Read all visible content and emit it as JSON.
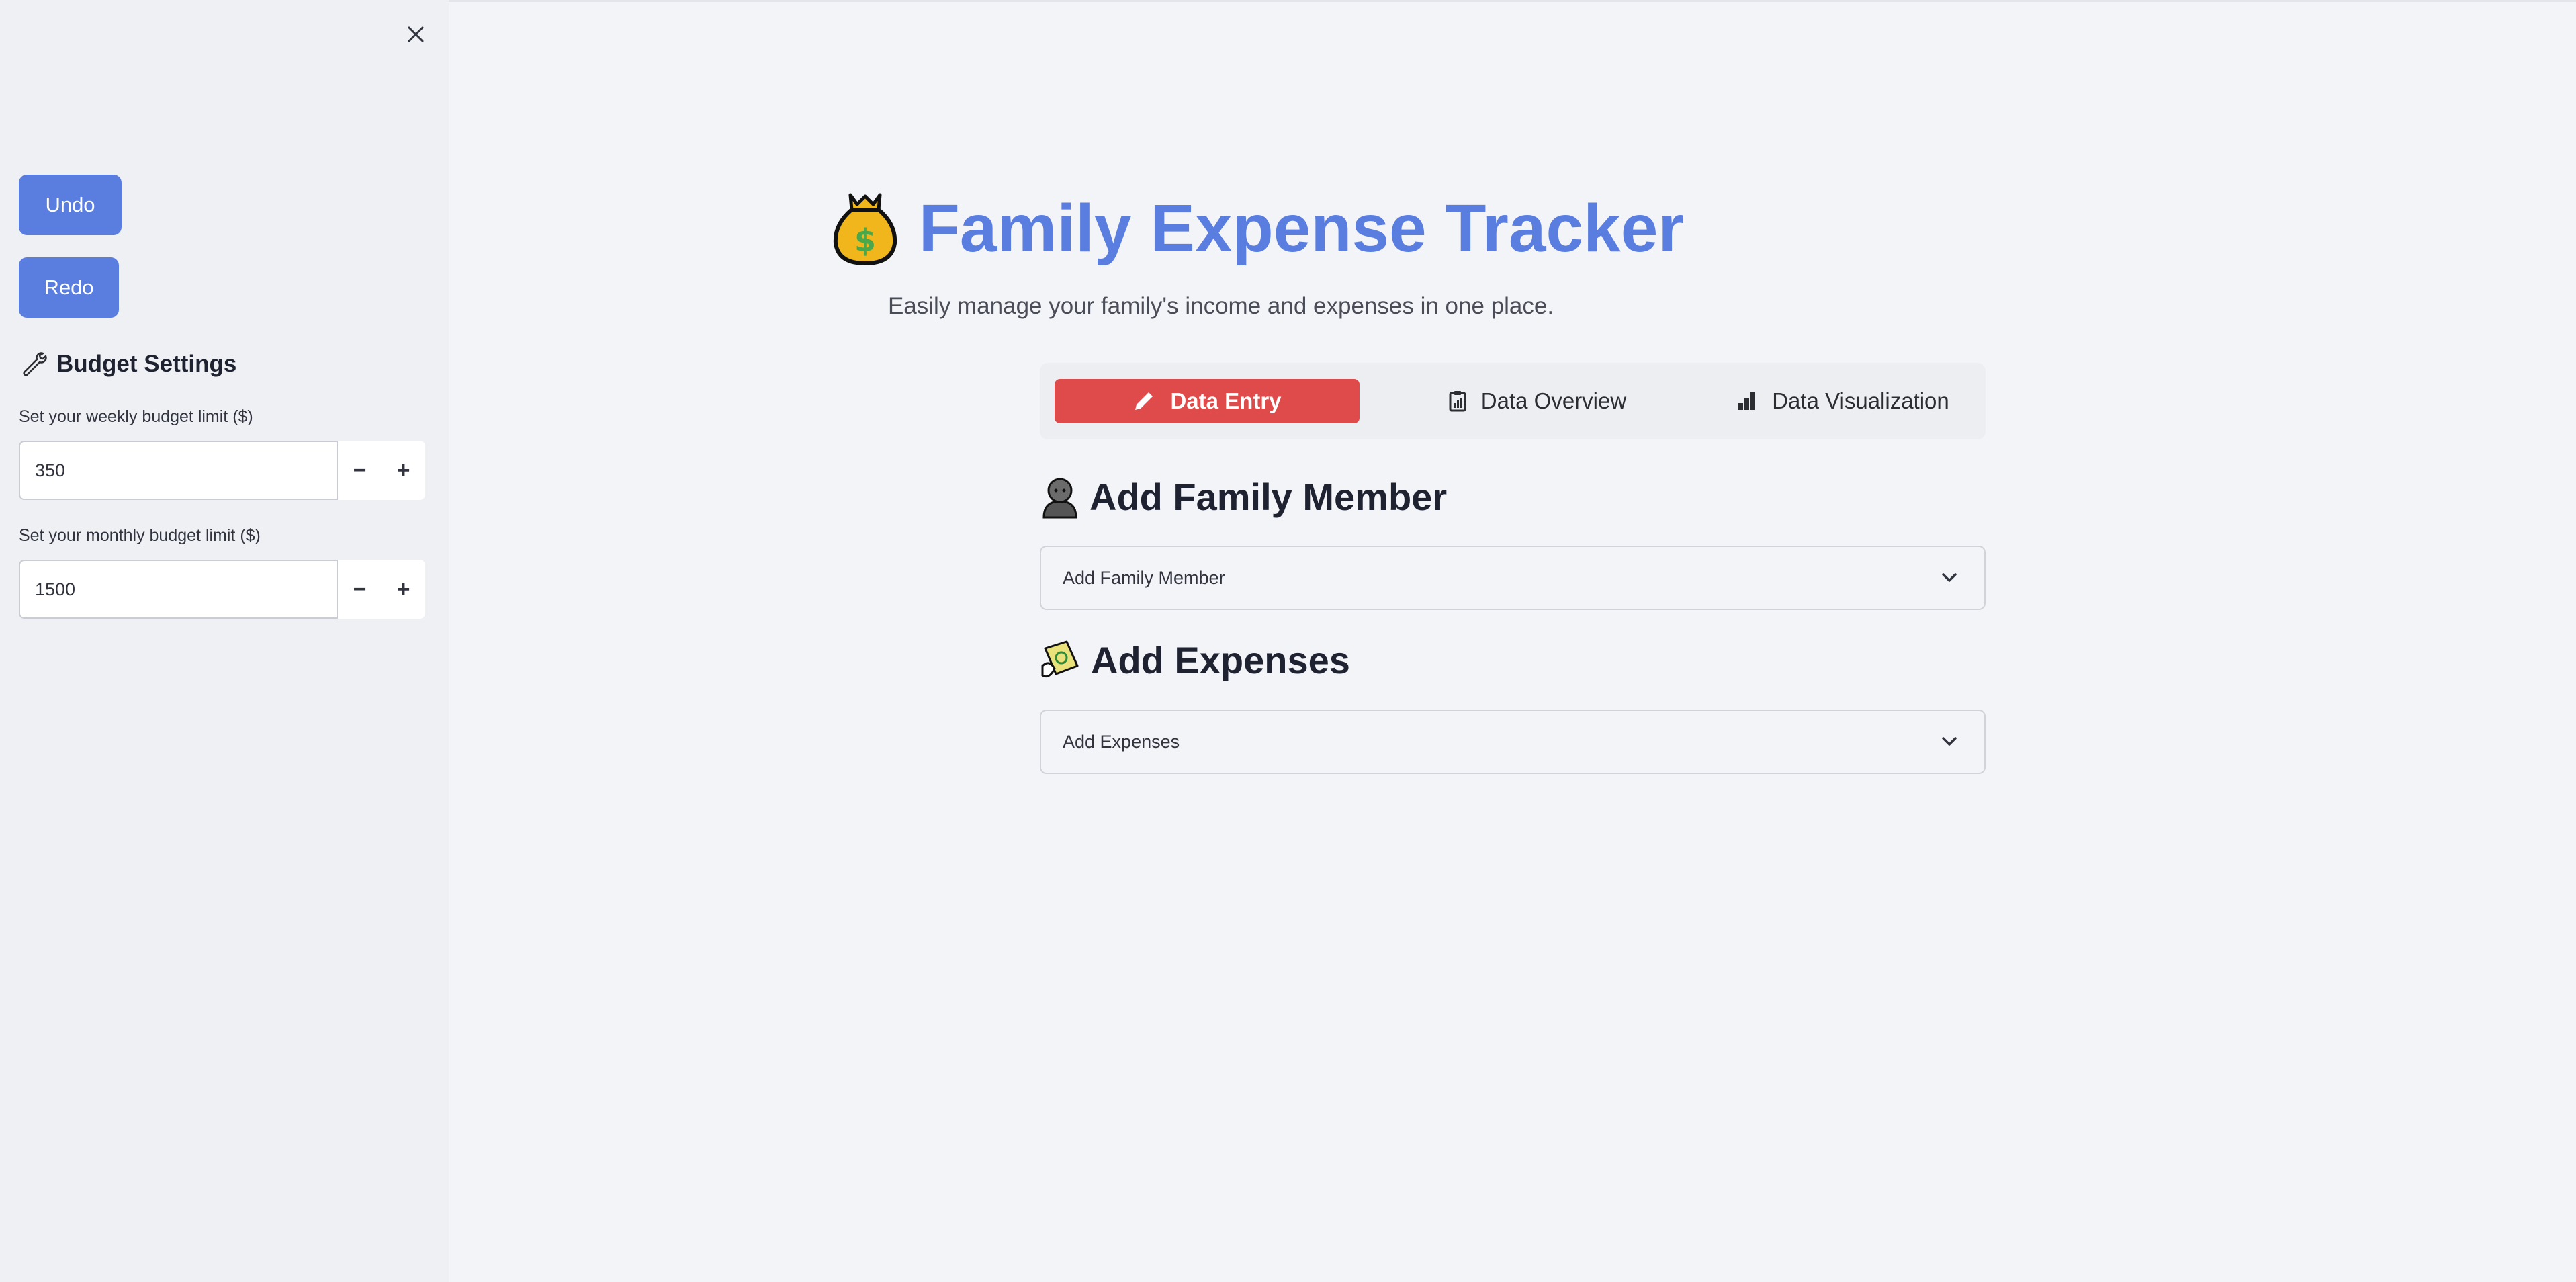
{
  "sidebar": {
    "undo_label": "Undo",
    "redo_label": "Redo",
    "heading": "Budget Settings",
    "weekly": {
      "label": "Set your weekly budget limit ($)",
      "value": "350"
    },
    "monthly": {
      "label": "Set your monthly budget limit ($)",
      "value": "1500"
    },
    "stepper_minus": "−",
    "stepper_plus": "+"
  },
  "header": {
    "title": "Family Expense Tracker",
    "subtitle": "Easily manage your family's income and expenses in one place."
  },
  "tabs": [
    {
      "label": "Data Entry",
      "icon": "pencil-icon",
      "active": true
    },
    {
      "label": "Data Overview",
      "icon": "clipboard-chart-icon"
    },
    {
      "label": "Data Visualization",
      "icon": "bar-chart-icon"
    }
  ],
  "sections": {
    "family": {
      "heading": "Add Family Member",
      "expander_label": "Add Family Member"
    },
    "expenses": {
      "heading": "Add Expenses",
      "expander_label": "Add Expenses"
    }
  },
  "colors": {
    "accent": "#5a7ee0",
    "active_tab": "#df4a4a",
    "background": "#f3f4f7",
    "sidebar": "#eef0f4"
  }
}
